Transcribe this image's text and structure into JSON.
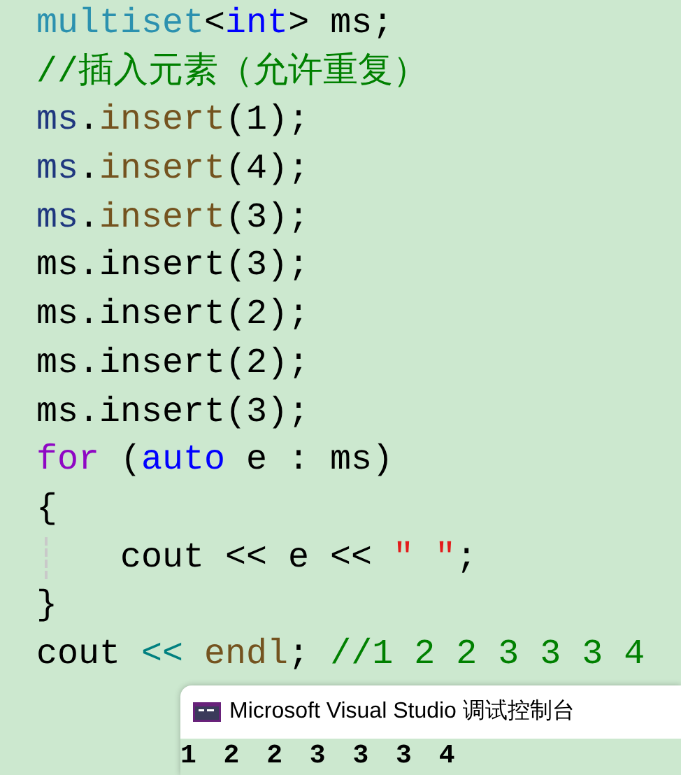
{
  "editor": {
    "lines": [
      {
        "indent_guide": false,
        "tokens": [
          {
            "text": "multiset",
            "kind": "type"
          },
          {
            "text": "<",
            "kind": "plain"
          },
          {
            "text": "int",
            "kind": "keyword"
          },
          {
            "text": "> ms;",
            "kind": "plain"
          }
        ]
      },
      {
        "indent_guide": false,
        "tokens": [
          {
            "text": "//插入元素（允许重复）",
            "kind": "comment"
          }
        ]
      },
      {
        "indent_guide": false,
        "tokens": [
          {
            "text": "ms",
            "kind": "variable"
          },
          {
            "text": ".",
            "kind": "plain"
          },
          {
            "text": "insert",
            "kind": "function"
          },
          {
            "text": "(1);",
            "kind": "plain"
          }
        ]
      },
      {
        "indent_guide": false,
        "tokens": [
          {
            "text": "ms",
            "kind": "variable"
          },
          {
            "text": ".",
            "kind": "plain"
          },
          {
            "text": "insert",
            "kind": "function"
          },
          {
            "text": "(4);",
            "kind": "plain"
          }
        ]
      },
      {
        "indent_guide": false,
        "tokens": [
          {
            "text": "ms",
            "kind": "variable"
          },
          {
            "text": ".",
            "kind": "plain"
          },
          {
            "text": "insert",
            "kind": "function"
          },
          {
            "text": "(3);",
            "kind": "plain"
          }
        ]
      },
      {
        "indent_guide": false,
        "tokens": [
          {
            "text": "ms.insert(3);",
            "kind": "plain"
          }
        ]
      },
      {
        "indent_guide": false,
        "tokens": [
          {
            "text": "ms.insert(2);",
            "kind": "plain"
          }
        ]
      },
      {
        "indent_guide": false,
        "tokens": [
          {
            "text": "ms.insert(2);",
            "kind": "plain"
          }
        ]
      },
      {
        "indent_guide": false,
        "tokens": [
          {
            "text": "ms.insert(3);",
            "kind": "plain"
          }
        ]
      },
      {
        "indent_guide": false,
        "tokens": [
          {
            "text": "for",
            "kind": "control"
          },
          {
            "text": " (",
            "kind": "plain"
          },
          {
            "text": "auto",
            "kind": "keyword"
          },
          {
            "text": " e : ms)",
            "kind": "plain"
          }
        ]
      },
      {
        "indent_guide": false,
        "tokens": [
          {
            "text": "{",
            "kind": "plain"
          }
        ]
      },
      {
        "indent_guide": true,
        "tokens": [
          {
            "text": "cout << e << ",
            "kind": "plain"
          },
          {
            "text": "\" \"",
            "kind": "string"
          },
          {
            "text": ";",
            "kind": "plain"
          }
        ]
      },
      {
        "indent_guide": false,
        "tokens": [
          {
            "text": "}",
            "kind": "plain"
          }
        ]
      },
      {
        "indent_guide": false,
        "tokens": [
          {
            "text": "cout ",
            "kind": "plain"
          },
          {
            "text": "<< ",
            "kind": "operator"
          },
          {
            "text": "endl",
            "kind": "function"
          },
          {
            "text": "; ",
            "kind": "plain"
          },
          {
            "text": "//1 2 2 3 3 3 4",
            "kind": "comment"
          }
        ]
      }
    ]
  },
  "console": {
    "title": "Microsoft Visual Studio 调试控制台",
    "output": "1 2 2 3 3 3 4"
  }
}
